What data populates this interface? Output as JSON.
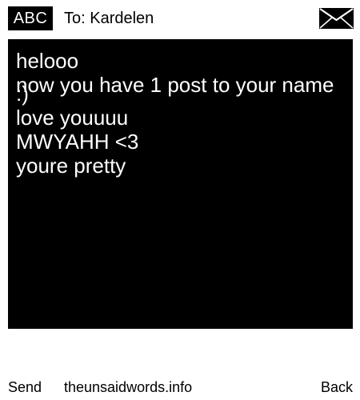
{
  "header": {
    "input_mode": "ABC",
    "to_label": "To: Kardelen",
    "envelope_icon": "envelope-icon"
  },
  "message": {
    "lines": [
      "helooo",
      "now you have 1 post to your name",
      ":)",
      "love youuuu",
      "MWYAHH <3",
      "youre pretty"
    ]
  },
  "softkeys": {
    "left": "Send",
    "center": "theunsaidwords.info",
    "right": "Back"
  },
  "colors": {
    "background": "#ffffff",
    "message_background": "#000000",
    "message_text": "#ffffff"
  }
}
